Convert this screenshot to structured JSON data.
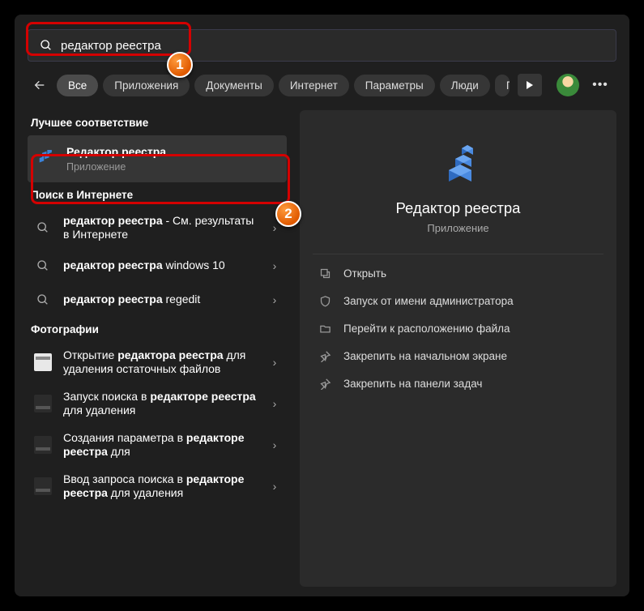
{
  "search": {
    "value": "редактор реестра"
  },
  "tabs": {
    "items": [
      "Все",
      "Приложения",
      "Документы",
      "Интернет",
      "Параметры",
      "Люди",
      "П"
    ],
    "active_index": 0
  },
  "left": {
    "best_match_header": "Лучшее соответствие",
    "best": {
      "title": "Редактор реестра",
      "sub": "Приложение"
    },
    "web_header": "Поиск в Интернете",
    "web_results": [
      {
        "pre": "редактор реестра",
        "post": " - См. результаты в Интернете"
      },
      {
        "pre": "редактор реестра",
        "post": " windows 10"
      },
      {
        "pre": "редактор реестра",
        "post": " regedit"
      }
    ],
    "photos_header": "Фотографии",
    "photo_results": [
      {
        "pre": "Открытие ",
        "mid": "редактора реестра",
        "post": " для удаления остаточных файлов"
      },
      {
        "pre": "Запуск поиска в ",
        "mid": "редакторе реестра",
        "post": " для удаления"
      },
      {
        "pre": "Создания параметра в ",
        "mid": "редакторе реестра",
        "post": " для"
      },
      {
        "pre": "Ввод запроса поиска в ",
        "mid": "редакторе реестра",
        "post": " для удаления"
      }
    ]
  },
  "detail": {
    "title": "Редактор реестра",
    "sub": "Приложение",
    "actions": [
      "Открыть",
      "Запуск от имени администратора",
      "Перейти к расположению файла",
      "Закрепить на начальном экране",
      "Закрепить на панели задач"
    ]
  },
  "badges": {
    "one": "1",
    "two": "2"
  }
}
